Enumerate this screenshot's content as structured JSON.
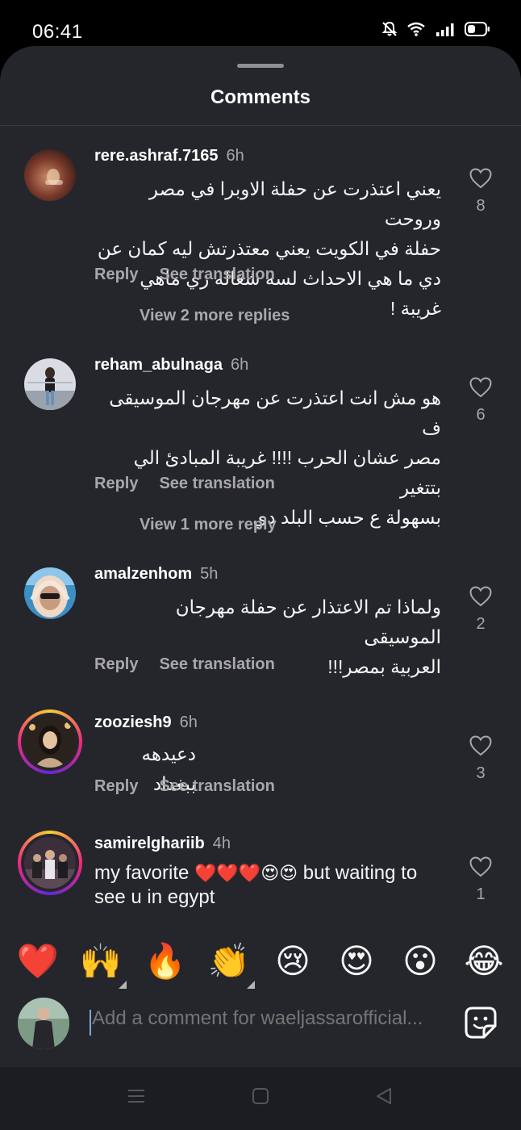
{
  "status_bar": {
    "time": "06:41",
    "icons": [
      "notifications-off-icon",
      "wifi-icon",
      "signal-icon",
      "battery-icon"
    ]
  },
  "sheet": {
    "title": "Comments"
  },
  "comments": [
    {
      "username": "rere.ashraf.7165",
      "time": "6h",
      "lines": [
        "يعني اعتذرت عن حفلة الاوبرا في مصر وروحت",
        "حفلة في الكويت يعني معتذرتش ليه كمان عن",
        "دي ما هي الاحداث لسه شغاله زي ماهي غريبة !"
      ],
      "reply": "Reply",
      "translate": "See translation",
      "likes": "8",
      "more_replies": "View 2 more replies"
    },
    {
      "username": "reham_abulnaga",
      "time": "6h",
      "lines": [
        "هو مش انت اعتذرت عن مهرجان الموسيقى ف",
        "مصر عشان الحرب !!!! غريبة المبادئ الي بتتغير",
        "بسهولة ع حسب البلد دي"
      ],
      "reply": "Reply",
      "translate": "See translation",
      "likes": "6",
      "more_replies": "View 1 more reply"
    },
    {
      "username": "amalzenhom",
      "time": "5h",
      "lines": [
        "ولماذا تم الاعتذار عن حفلة مهرجان الموسيقى",
        "العربية بمصر!!!"
      ],
      "reply": "Reply",
      "translate": "See translation",
      "likes": "2"
    },
    {
      "username": "zooziesh9",
      "time": "6h",
      "lines": [
        "دعيدهه ببغداد"
      ],
      "reply": "Reply",
      "translate": "See translation",
      "likes": "3"
    },
    {
      "username": "samirelghariib",
      "time": "4h",
      "text_before": "my favorite ",
      "emojis": "❤️❤️❤️😍😍",
      "text_after": " but waiting to see u in egypt",
      "likes": "1"
    }
  ],
  "reactions": [
    "❤️",
    "🙌",
    "🔥",
    "👏",
    "😢",
    "😍",
    "😮",
    "😂"
  ],
  "composer": {
    "placeholder": "Add a comment for waeljassarofficial..."
  },
  "nav": [
    "menu-icon",
    "home-icon",
    "back-icon"
  ]
}
